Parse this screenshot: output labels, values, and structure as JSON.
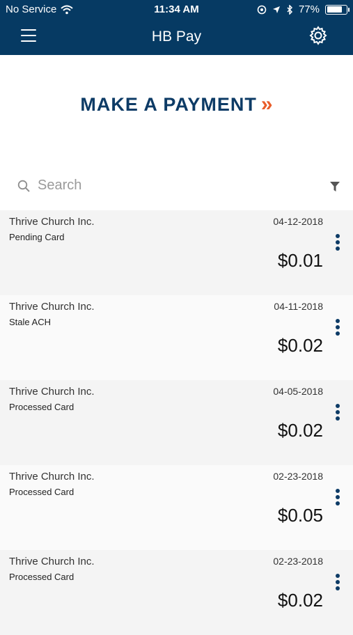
{
  "status_bar": {
    "carrier": "No Service",
    "time": "11:34 AM",
    "battery": "77%",
    "battery_level": 0.77
  },
  "appbar": {
    "title": "HB Pay",
    "menu_icon": "hamburger-menu-icon",
    "settings_icon": "gear-icon"
  },
  "payment": {
    "label": "MAKE A PAYMENT",
    "chevron": "»"
  },
  "search": {
    "placeholder": "Search",
    "filter_icon": "filter-icon"
  },
  "transactions": [
    {
      "name": "Thrive Church Inc.",
      "status": "Pending Card",
      "date": "04-12-2018",
      "amount": "$0.01"
    },
    {
      "name": "Thrive Church Inc.",
      "status": "Stale ACH",
      "date": "04-11-2018",
      "amount": "$0.02"
    },
    {
      "name": "Thrive Church Inc.",
      "status": "Processed Card",
      "date": "04-05-2018",
      "amount": "$0.02"
    },
    {
      "name": "Thrive Church Inc.",
      "status": "Processed Card",
      "date": "02-23-2018",
      "amount": "$0.05"
    },
    {
      "name": "Thrive Church Inc.",
      "status": "Processed Card",
      "date": "02-23-2018",
      "amount": "$0.02"
    }
  ],
  "colors": {
    "header": "#063a63",
    "accent": "#e95d2a",
    "title": "#0d3b66"
  }
}
